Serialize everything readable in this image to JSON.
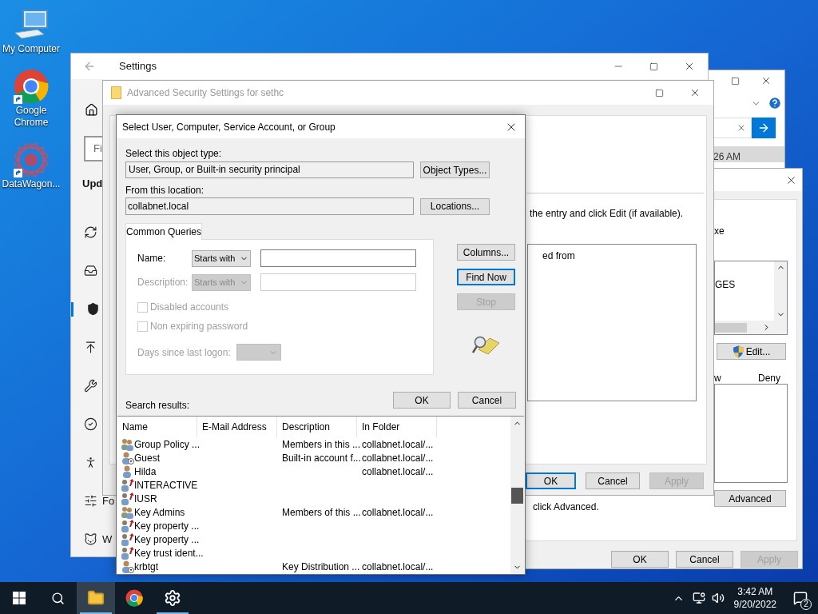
{
  "desktop_icons": [
    {
      "kind": "computer",
      "label": "My Computer",
      "shortcut": false
    },
    {
      "kind": "chrome",
      "label": "Google Chrome",
      "shortcut": true
    },
    {
      "kind": "app",
      "label": "DataWagon...",
      "shortcut": true
    }
  ],
  "background_window": {
    "time_fragment": "26 AM"
  },
  "settings_window": {
    "title": "Settings",
    "search_placeholder": "Fi",
    "heading": "Upd",
    "nav": [
      {
        "kind": "sync",
        "selected": false
      },
      {
        "kind": "delivery",
        "selected": false
      },
      {
        "kind": "security",
        "selected": true
      },
      {
        "kind": "backup",
        "selected": false
      },
      {
        "kind": "troubleshoot",
        "selected": false
      },
      {
        "kind": "activation",
        "selected": false
      },
      {
        "kind": "find",
        "selected": false
      },
      {
        "kind": "developers",
        "selected": false,
        "label": "Fo"
      },
      {
        "kind": "insider",
        "selected": false,
        "label": "W"
      }
    ]
  },
  "properties_window": {
    "name_fragment": "xe",
    "list_item": "GES",
    "edit_button": "Edit...",
    "allow_fragment": "w",
    "deny_label": "Deny",
    "note": "click Advanced.",
    "advanced_button": "Advanced",
    "buttons": [
      {
        "label": "OK",
        "disabled": false
      },
      {
        "label": "Cancel",
        "disabled": false
      },
      {
        "label": "Apply",
        "disabled": true
      }
    ]
  },
  "advanced_window": {
    "title": "Advanced Security Settings for sethc",
    "instruction": "the entry and click Edit (if available).",
    "list_fragment": "ed from",
    "buttons": [
      {
        "label": "OK",
        "default": true,
        "disabled": false
      },
      {
        "label": "Cancel",
        "default": false,
        "disabled": false
      },
      {
        "label": "Apply",
        "default": false,
        "disabled": true
      }
    ]
  },
  "select_dialog": {
    "title": "Select User, Computer, Service Account, or Group",
    "object_type_label": "Select this object type:",
    "object_type": "User, Group, or Built-in security principal",
    "object_types_button": "Object Types...",
    "location_label": "From this location:",
    "location": "collabnet.local",
    "locations_button": "Locations...",
    "tab": "Common Queries",
    "name_label": "Name:",
    "name_match": "Starts with",
    "description_label": "Description:",
    "description_match": "Starts with",
    "description_disabled": true,
    "checkboxes": [
      {
        "label": "Disabled accounts",
        "checked": false,
        "disabled": true
      },
      {
        "label": "Non expiring password",
        "checked": false,
        "disabled": true
      }
    ],
    "days_label": "Days since last logon:",
    "side_buttons": [
      {
        "label": "Columns...",
        "default": false,
        "disabled": false
      },
      {
        "label": "Find Now",
        "default": true,
        "disabled": false
      },
      {
        "label": "Stop",
        "default": false,
        "disabled": true
      }
    ],
    "ok_button": "OK",
    "cancel_button": "Cancel",
    "results_label": "Search results:",
    "columns": [
      "Name",
      "E-Mail Address",
      "Description",
      "In Folder"
    ],
    "rows": [
      {
        "kind": "group",
        "name": "Group Policy ...",
        "description": "Members in this ...",
        "folder": "collabnet.local/..."
      },
      {
        "kind": "user_disabled",
        "name": "Guest",
        "description": "Built-in account f...",
        "folder": "collabnet.local/..."
      },
      {
        "kind": "user",
        "name": "Hilda",
        "folder": "collabnet.local/..."
      },
      {
        "kind": "special",
        "name": "INTERACTIVE"
      },
      {
        "kind": "special",
        "name": "IUSR"
      },
      {
        "kind": "group",
        "name": "Key Admins",
        "description": "Members of this ...",
        "folder": "collabnet.local/..."
      },
      {
        "kind": "special",
        "name": "Key property ..."
      },
      {
        "kind": "special",
        "name": "Key property ..."
      },
      {
        "kind": "special",
        "name": "Key trust ident..."
      },
      {
        "kind": "user_disabled",
        "name": "krbtgt",
        "description": "Key Distribution ...",
        "folder": "collabnet.local/..."
      }
    ]
  },
  "taskbar": {
    "apps": [
      {
        "kind": "explorer",
        "active": true,
        "running": true
      },
      {
        "kind": "chrome",
        "active": false,
        "running": false
      },
      {
        "kind": "settings",
        "active": false,
        "running": true
      }
    ],
    "time": "3:42 AM",
    "date": "9/20/2022",
    "notifications": "2"
  }
}
